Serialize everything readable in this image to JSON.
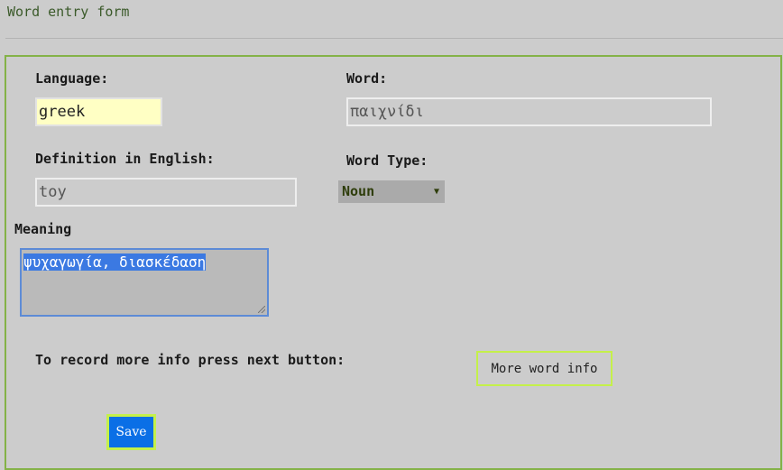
{
  "page": {
    "title": "Word entry form"
  },
  "form": {
    "language": {
      "label": "Language:",
      "value": "greek"
    },
    "word": {
      "label": "Word:",
      "value": "παιχνίδι"
    },
    "definition": {
      "label": "Definition in English:",
      "value": "toy"
    },
    "word_type": {
      "label": "Word Type:",
      "selected": "Noun"
    },
    "meaning": {
      "label": "Meaning",
      "value": "ψυχαγωγία, διασκέδαση"
    },
    "more_info": {
      "prompt": "To record more info press next button:",
      "button_label": "More word info"
    },
    "save_label": "Save"
  },
  "colors": {
    "background": "#cccccc",
    "form_border": "#84b247",
    "language_field_bg": "#ffffc4",
    "selection": "#3b79e2",
    "save_button": "#0a6fe6",
    "button_border": "#c4f04a"
  },
  "icons": {
    "select_arrow": "caret-down-icon",
    "textarea_grip": "resize-grip-icon"
  }
}
